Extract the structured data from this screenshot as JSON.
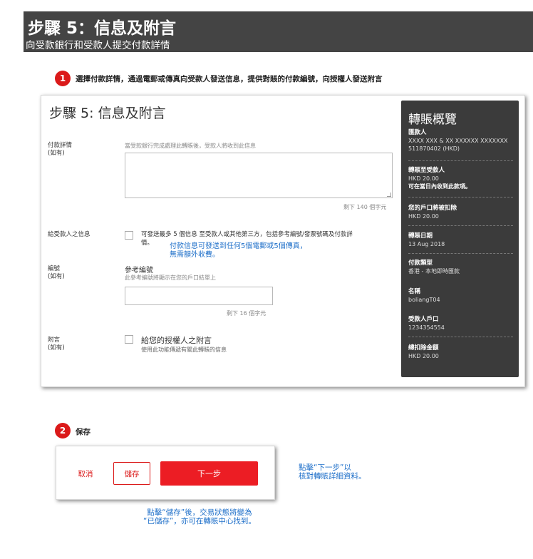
{
  "banner": {
    "title": "步驟 5：信息及附言",
    "subtitle": "向受款銀行和受款人提交付款詳情"
  },
  "step1": {
    "number": "1",
    "text": "選擇付款詳情，通過電郵或傳真向受款人發送信息，提供對賬的付款編號，向授權人發送附言"
  },
  "form": {
    "title": "步驟 5: 信息及附言",
    "payment_details": {
      "label": "付款詳情",
      "optional": "(如有)",
      "hint": "當受款銀行完成處理此轉賬後，受款人將收到此信息",
      "value": "",
      "remaining": "剩下 140 個字元"
    },
    "payee_message": {
      "label": "給受款人之信息",
      "checkbox_text_1": "可發送最多 5 個信息 至受款人或其他第三方，包括參考編號/發票號碼及付款詳",
      "checkbox_text_2": "情。",
      "note_1": "付款信息可發送到任何5個電郵或5個傳真，",
      "note_2": "無需額外收費。"
    },
    "reference": {
      "label": "編號",
      "optional": "(如有)",
      "heading": "參考編號",
      "hint": "此參考編號將顯示在您的戶口結單上",
      "value": "",
      "remaining": "剩下 16 個字元"
    },
    "attachment": {
      "label": "附言",
      "optional": "(如有)",
      "heading": "給您的授權人之附言",
      "hint": "使用此功能傳遞有關此轉賬的信息"
    }
  },
  "summary": {
    "title": "轉賬概覽",
    "items": [
      {
        "label": "匯款人",
        "value1": "XXXX XXX & XX XXXXXX XXXXXXX",
        "value2": "511870402 (HKD)"
      },
      {
        "label": "轉賬至受款人",
        "value1": "HKD 20.00",
        "value2": "可在當日內收到此款項。"
      },
      {
        "label": "您的戶口將被扣除",
        "value1": "HKD 20.00"
      },
      {
        "label": "轉賬日期",
        "value1": "13 Aug 2018"
      },
      {
        "label": "付款類型",
        "value1": "香港 - 本地即時匯款"
      },
      {
        "label": "名稱",
        "value1": "boliangT04"
      },
      {
        "label": "受款人戶口",
        "value1": "1234354554"
      },
      {
        "label": "總扣除金額",
        "value1": "HKD 20.00"
      }
    ]
  },
  "step2": {
    "number": "2",
    "text": "保存"
  },
  "buttons": {
    "cancel": "取消",
    "save": "儲存",
    "next": "下一步"
  },
  "callouts": {
    "next_1": "點擊“下一步”以",
    "next_2": "核對轉賬詳細資料。",
    "save_1": "點擊“儲存”後，交易狀態將變為",
    "save_2": "“已儲存”，亦可在轉賬中心找到。"
  },
  "colors": {
    "accent_red": "#ec1d24",
    "banner_bg": "#444444",
    "summary_bg": "#3b3b3b",
    "note_blue": "#1e6fc9"
  }
}
